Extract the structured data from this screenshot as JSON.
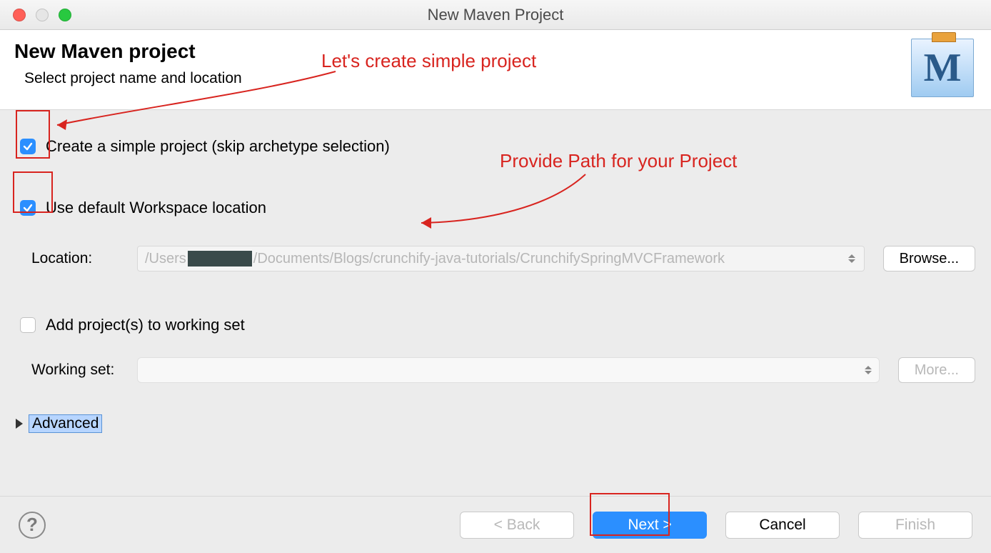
{
  "window": {
    "title": "New Maven Project"
  },
  "header": {
    "title": "New Maven project",
    "subtitle": "Select project name and location",
    "icon_letter": "M"
  },
  "options": {
    "simple_project": {
      "label": "Create a simple project (skip archetype selection)",
      "checked": true
    },
    "default_workspace": {
      "label": "Use default Workspace location",
      "checked": true
    },
    "location_label": "Location:",
    "location_path_before": "/Users",
    "location_path_after": "/Documents/Blogs/crunchify-java-tutorials/CrunchifySpringMVCFramework",
    "browse": "Browse...",
    "add_working_set": {
      "label": "Add project(s) to working set",
      "checked": false
    },
    "working_set_label": "Working set:",
    "more": "More...",
    "advanced": "Advanced"
  },
  "footer": {
    "back": "< Back",
    "next": "Next >",
    "cancel": "Cancel",
    "finish": "Finish"
  },
  "annotations": {
    "simple": "Let's create simple project",
    "path": "Provide Path for your Project"
  }
}
